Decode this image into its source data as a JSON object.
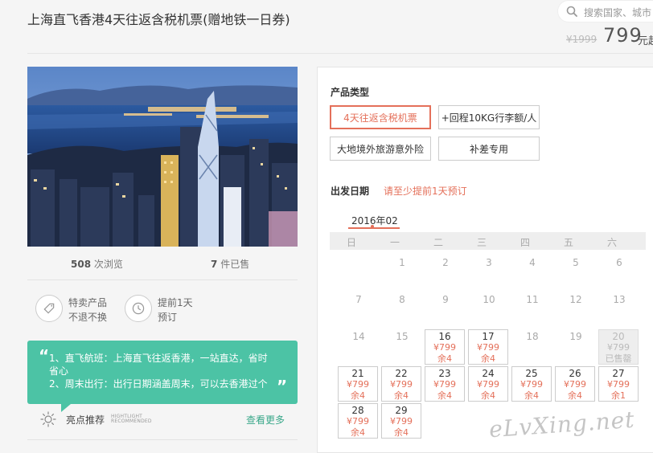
{
  "header": {
    "title": "上海直飞香港4天往返含税机票(赠地铁一日券)",
    "search_placeholder": "搜索国家、城市",
    "price_original": "¥1999",
    "price_current": "799",
    "price_unit": "元起"
  },
  "stats": {
    "views_count": "508",
    "views_label": "次浏览",
    "sold_count": "7",
    "sold_label": "件已售"
  },
  "features": [
    {
      "line1": "特卖产品",
      "line2": "不退不换",
      "icon": "tag-icon"
    },
    {
      "line1": "提前1天",
      "line2": "预订",
      "icon": "clock-icon"
    }
  ],
  "highlight": {
    "quote_open": "“",
    "quote_close": "”",
    "line1": "1、直飞航班：上海直飞往返香港，一站直达，省时",
    "line2": "省心",
    "line3": "2、周末出行：出行日期涵盖周末，可以去香港过个"
  },
  "recommend": {
    "title": "亮点推荐",
    "en_line1": "HIGHTLIGHT",
    "en_line2": "RECOMMENDED",
    "more": "查看更多"
  },
  "booking": {
    "type_label": "产品类型",
    "options": [
      "4天往返含税机票",
      "+回程10KG行李额/人",
      "大地境外旅游意外险",
      "补差专用"
    ],
    "selected_option": 0,
    "date_label": "出发日期",
    "date_note": "请至少提前1天预订",
    "month": "2016年02",
    "weekdays": [
      "日",
      "一",
      "二",
      "三",
      "四",
      "五",
      "六"
    ],
    "week1": [
      "1",
      "2",
      "3",
      "4",
      "5",
      "6"
    ],
    "week2": [
      "7",
      "8",
      "9",
      "10",
      "11",
      "12",
      "13"
    ],
    "week3_plain": [
      "14",
      "15"
    ],
    "week3_avail": [
      {
        "day": "16",
        "price": "¥799",
        "stock": "余4"
      },
      {
        "day": "17",
        "price": "¥799",
        "stock": "余4"
      }
    ],
    "week3_plain2": [
      "18",
      "19"
    ],
    "week3_sold": {
      "day": "20",
      "price": "¥799",
      "stock": "已售罄"
    },
    "week4": [
      {
        "day": "21",
        "price": "¥799",
        "stock": "余4"
      },
      {
        "day": "22",
        "price": "¥799",
        "stock": "余4"
      },
      {
        "day": "23",
        "price": "¥799",
        "stock": "余4"
      },
      {
        "day": "24",
        "price": "¥799",
        "stock": "余4"
      },
      {
        "day": "25",
        "price": "¥799",
        "stock": "余4"
      },
      {
        "day": "26",
        "price": "¥799",
        "stock": "余4"
      },
      {
        "day": "27",
        "price": "¥799",
        "stock": "余1"
      }
    ],
    "week5": [
      {
        "day": "28",
        "price": "¥799",
        "stock": "余4"
      },
      {
        "day": "29",
        "price": "¥799",
        "stock": "余4"
      }
    ]
  },
  "watermark": "eLvXing.net",
  "colors": {
    "accent": "#e4705a",
    "teal": "#4cc3a5"
  }
}
